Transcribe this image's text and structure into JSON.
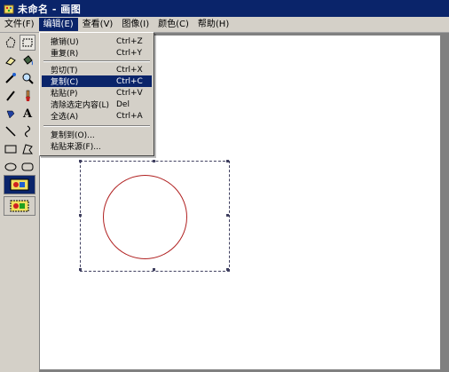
{
  "window": {
    "title": "未命名 - 画图"
  },
  "menubar": {
    "items": [
      {
        "label": "文件(F)"
      },
      {
        "label": "编辑(E)"
      },
      {
        "label": "查看(V)"
      },
      {
        "label": "图像(I)"
      },
      {
        "label": "颜色(C)"
      },
      {
        "label": "帮助(H)"
      }
    ]
  },
  "edit_menu": {
    "items": [
      {
        "label": "撤销(U)",
        "shortcut": "Ctrl+Z"
      },
      {
        "label": "重复(R)",
        "shortcut": "Ctrl+Y"
      },
      {
        "label": "剪切(T)",
        "shortcut": "Ctrl+X"
      },
      {
        "label": "复制(C)",
        "shortcut": "Ctrl+C"
      },
      {
        "label": "粘贴(P)",
        "shortcut": "Ctrl+V"
      },
      {
        "label": "清除选定内容(L)",
        "shortcut": "Del"
      },
      {
        "label": "全选(A)",
        "shortcut": "Ctrl+A"
      },
      {
        "label": "复制到(O)...",
        "shortcut": ""
      },
      {
        "label": "粘贴来源(F)...",
        "shortcut": ""
      }
    ],
    "highlighted": "复制(C)"
  },
  "toolbox": {
    "tools": [
      {
        "icon": "free-select-icon"
      },
      {
        "icon": "rect-select-icon"
      },
      {
        "icon": "eraser-icon"
      },
      {
        "icon": "fill-bucket-icon"
      },
      {
        "icon": "color-picker-icon"
      },
      {
        "icon": "magnifier-icon"
      },
      {
        "icon": "pencil-icon"
      },
      {
        "icon": "brush-icon"
      },
      {
        "icon": "airbrush-icon"
      },
      {
        "icon": "text-icon",
        "glyph": "A"
      },
      {
        "icon": "line-icon"
      },
      {
        "icon": "curve-icon"
      },
      {
        "icon": "rectangle-icon"
      },
      {
        "icon": "polygon-icon"
      },
      {
        "icon": "ellipse-icon"
      },
      {
        "icon": "rounded-rect-icon"
      }
    ]
  },
  "colors": {
    "accent": "#0a246a",
    "circle_stroke": "#b02020",
    "chrome": "#d4d0c8"
  }
}
